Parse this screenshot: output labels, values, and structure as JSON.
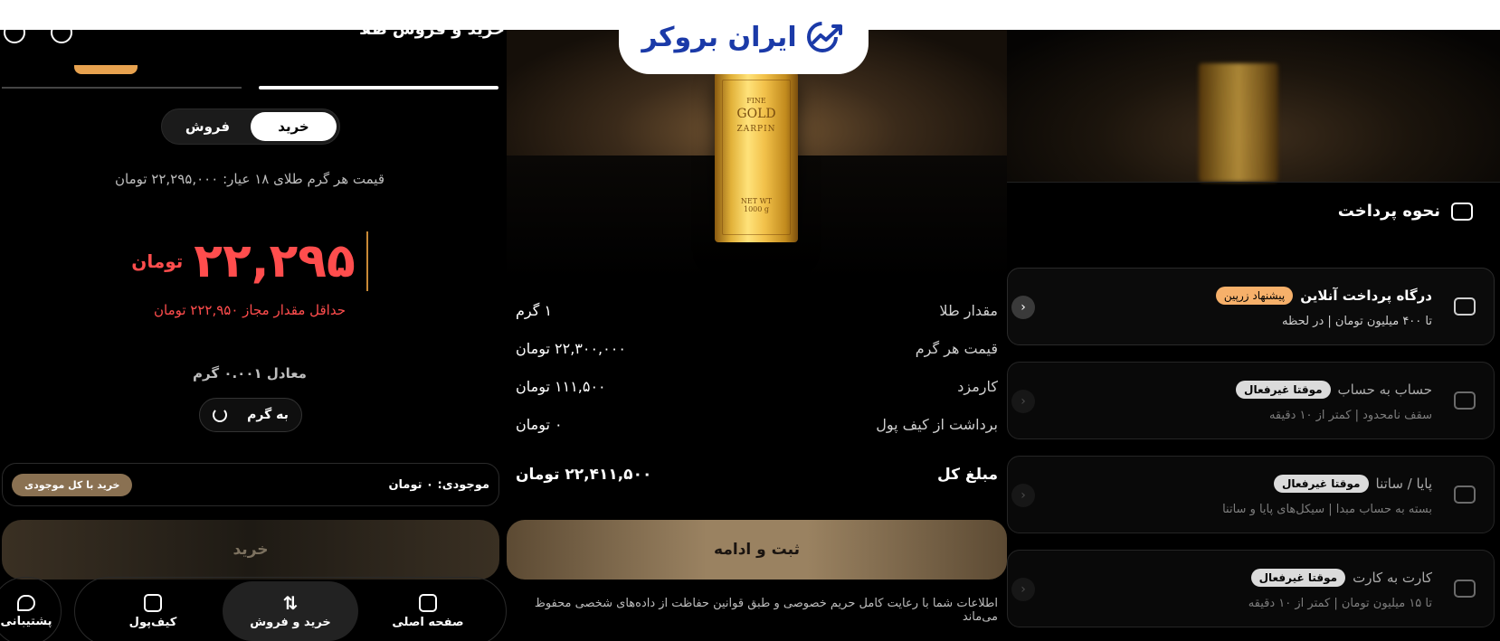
{
  "brand": {
    "logo_text": "ایران بروکر"
  },
  "panel1": {
    "header_title": "خرید و فروش طلا",
    "segment": {
      "buy": "خرید",
      "sell": "فروش"
    },
    "unit_price": "قیمت هر گرم طلای ۱۸ عیار: ۲۲,۲۹۵,۰۰۰ تومان",
    "amount_value": "۲۲,۲۹۵",
    "amount_unit": "تومان",
    "min_amount": "حداقل مقدار مجاز ۲۲۲,۹۵۰ تومان",
    "equivalent": "معادل ۰.۰۰۱ گرم",
    "to_gram": "به گرم",
    "balance": "موجودی: ۰ تومان",
    "buy_all": "خرید با کل موجودی",
    "buy_button": "خرید",
    "nav": {
      "home": "صفحه اصلی",
      "trade": "خرید و فروش",
      "wallet": "کیف‌پول",
      "support": "پشتیبانی"
    }
  },
  "panel2": {
    "gold_bar": {
      "fine": "FINE",
      "gold": "GOLD",
      "brand": "ZARPIN",
      "net": "NET WT",
      "weight": "1000 g"
    },
    "rows": [
      {
        "label": "مقدار طلا",
        "value": "۱ گرم"
      },
      {
        "label": "قیمت هر گرم",
        "value": "۲۲,۳۰۰,۰۰۰ تومان"
      },
      {
        "label": "کارمزد",
        "value": "۱۱۱,۵۰۰ تومان"
      },
      {
        "label": "برداشت از کیف پول",
        "value": "۰ تومان"
      }
    ],
    "total": {
      "label": "مبلغ کل",
      "value": "۲۲,۴۱۱,۵۰۰ تومان"
    },
    "submit": "ثبت و ادامه",
    "privacy": "اطلاعات شما با رعایت کامل حریم خصوصی و طبق قوانین حفاظت از داده‌های شخصی محفوظ می‌ماند"
  },
  "panel3": {
    "title": "نحوه پرداخت",
    "methods": [
      {
        "name": "درگاه پرداخت آنلاین",
        "badge": "پیشنهاد زرپین",
        "sub": "تا ۴۰۰ میلیون تومان | در لحظه"
      },
      {
        "name": "حساب به حساب",
        "badge": "موقتا غیرفعال",
        "sub": "سقف نامحدود | کمتر از ۱۰ دقیقه"
      },
      {
        "name": "پایا / ساتنا",
        "badge": "موقتا غیرفعال",
        "sub": "بسته به حساب مبدا | سیکل‌های پایا و ساتنا"
      },
      {
        "name": "کارت به کارت",
        "badge": "موقتا غیرفعال",
        "sub": "تا ۱۵ میلیون تومان | کمتر از ۱۰ دقیقه"
      }
    ]
  },
  "colors": {
    "accent_red": "#ff4d4d",
    "gold": "#e2b23a",
    "brand_blue": "#1b3aa8",
    "badge_orange": "#f6b06a"
  }
}
